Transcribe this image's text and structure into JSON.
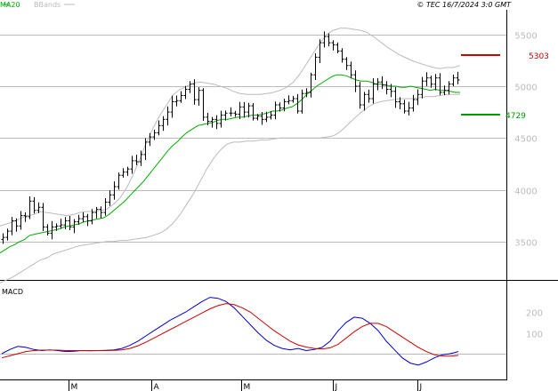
{
  "header": {
    "legend_ma": "MA20",
    "legend_bb": "BBands",
    "copyright": "© TEC 16/7/2024 3:0 GMT",
    "ma_color": "#00aa00",
    "bb_color": "#bbbbbb"
  },
  "chart_data": [
    {
      "type": "ohlc",
      "title": "",
      "y_ticks": [
        "5500",
        "5000",
        "4500",
        "4000",
        "3500"
      ],
      "y_values": [
        5500,
        5000,
        4500,
        4000,
        3500
      ],
      "ylim": [
        3300,
        5550
      ],
      "grid": true,
      "x_ticks": [
        "M",
        "A",
        "M",
        "J",
        "J"
      ],
      "levels": [
        {
          "name": "resistance",
          "label": "5303",
          "value": 5303,
          "color": "#cc0000"
        },
        {
          "name": "support",
          "label": "4729",
          "value": 4729,
          "color": "#009900"
        }
      ],
      "close_series": [
        3540,
        3600,
        3700,
        3650,
        3750,
        3740,
        3890,
        3800,
        3830,
        3640,
        3580,
        3640,
        3650,
        3660,
        3700,
        3640,
        3690,
        3720,
        3740,
        3700,
        3780,
        3810,
        3780,
        3880,
        3950,
        4030,
        4140,
        4170,
        4200,
        4280,
        4270,
        4340,
        4460,
        4510,
        4550,
        4620,
        4680,
        4750,
        4850,
        4860,
        4910,
        4970,
        5020,
        4870,
        4960,
        4700,
        4660,
        4680,
        4640,
        4720,
        4740,
        4740,
        4730,
        4800,
        4750,
        4810,
        4690,
        4710,
        4680,
        4700,
        4720,
        4820,
        4790,
        4850,
        4860,
        4880,
        4760,
        4930,
        4940,
        5110,
        5280,
        5420,
        5480,
        5420,
        5400,
        5340,
        5260,
        5200,
        5110,
        5000,
        4820,
        4920,
        4880,
        5020,
        5040,
        5010,
        4970,
        4950,
        4850,
        4830,
        4760,
        4790,
        4870,
        4920,
        5050,
        5080,
        5020,
        5080,
        4940,
        4960,
        5020,
        5080,
        5060
      ],
      "ma20": [
        3390,
        3420,
        3450,
        3470,
        3500,
        3520,
        3560,
        3570,
        3580,
        3590,
        3600,
        3610,
        3620,
        3640,
        3650,
        3660,
        3670,
        3690,
        3700,
        3710,
        3720,
        3730,
        3760,
        3800,
        3840,
        3880,
        3930,
        3980,
        4030,
        4080,
        4140,
        4200,
        4260,
        4320,
        4380,
        4430,
        4470,
        4520,
        4560,
        4590,
        4620,
        4630,
        4640,
        4650,
        4670,
        4680,
        4680,
        4690,
        4700,
        4700,
        4710,
        4720,
        4720,
        4730,
        4740,
        4760,
        4760,
        4770,
        4790,
        4800,
        4830,
        4870,
        4920,
        4960,
        5000,
        5030,
        5060,
        5090,
        5110,
        5110,
        5100,
        5080,
        5060,
        5050,
        5050,
        5040,
        5020,
        5020,
        5010,
        5000,
        5000,
        4990,
        4990,
        5000,
        4990,
        4980,
        4970,
        4960,
        4970,
        4960,
        4960,
        4950,
        4940,
        4940
      ],
      "bb_upper": [
        3650,
        3670,
        3690,
        3720,
        3750,
        3760,
        3790,
        3780,
        3770,
        3760,
        3750,
        3760,
        3780,
        3790,
        3790,
        3800,
        3810,
        3860,
        3920,
        4020,
        4150,
        4300,
        4460,
        4600,
        4720,
        4820,
        4920,
        4970,
        5000,
        5030,
        5040,
        5030,
        5020,
        5000,
        4980,
        4950,
        4930,
        4920,
        4920,
        4920,
        4930,
        4940,
        4960,
        4990,
        5040,
        5120,
        5220,
        5320,
        5420,
        5500,
        5540,
        5560,
        5560,
        5550,
        5540,
        5520,
        5480,
        5430,
        5380,
        5340,
        5300,
        5270,
        5240,
        5220,
        5200,
        5180,
        5170,
        5180,
        5180,
        5200
      ],
      "bb_lower": [
        3100,
        3130,
        3160,
        3200,
        3240,
        3280,
        3320,
        3340,
        3380,
        3400,
        3420,
        3440,
        3460,
        3470,
        3480,
        3490,
        3500,
        3500,
        3510,
        3510,
        3520,
        3530,
        3540,
        3560,
        3580,
        3620,
        3680,
        3760,
        3860,
        3960,
        4080,
        4200,
        4300,
        4380,
        4440,
        4460,
        4460,
        4470,
        4470,
        4480,
        4480,
        4490,
        4500,
        4500,
        4500,
        4500,
        4500,
        4500,
        4500,
        4510,
        4520,
        4560,
        4620,
        4680,
        4740,
        4790,
        4830,
        4850,
        4860,
        4870,
        4880,
        4880,
        4880,
        4890,
        4900,
        4900,
        4910,
        4920,
        4920,
        4920
      ],
      "line_colors": {
        "ma": "#00aa00",
        "bb": "#bbbbbb",
        "bars": "#000000"
      }
    },
    {
      "type": "line",
      "title": "MACD",
      "y_ticks": [
        "200",
        "100"
      ],
      "y_values": [
        200,
        100
      ],
      "ylim": [
        -120,
        270
      ],
      "x_ticks": [
        "M",
        "A",
        "M",
        "J",
        "J"
      ],
      "series": [
        {
          "name": "",
          "color": "#0000cc",
          "values": [
            0,
            20,
            35,
            30,
            20,
            15,
            18,
            15,
            10,
            12,
            15,
            14,
            15,
            16,
            18,
            25,
            40,
            60,
            85,
            110,
            135,
            160,
            180,
            200,
            225,
            250,
            270,
            265,
            250,
            220,
            180,
            140,
            100,
            65,
            40,
            25,
            18,
            25,
            15,
            20,
            30,
            60,
            110,
            150,
            175,
            170,
            145,
            110,
            60,
            20,
            -20,
            -45,
            -55,
            -40,
            -20,
            -5,
            0,
            10
          ]
        },
        {
          "name": "",
          "color": "#cc0000",
          "values": [
            -20,
            -10,
            0,
            10,
            15,
            17,
            17,
            17,
            15,
            15,
            15,
            15,
            15,
            15,
            16,
            18,
            25,
            38,
            55,
            75,
            95,
            115,
            135,
            155,
            175,
            195,
            215,
            230,
            240,
            235,
            220,
            200,
            170,
            140,
            110,
            85,
            60,
            42,
            32,
            25,
            22,
            28,
            45,
            75,
            105,
            130,
            145,
            145,
            130,
            105,
            80,
            55,
            30,
            10,
            -5,
            -12,
            -12,
            -8
          ]
        }
      ]
    }
  ]
}
